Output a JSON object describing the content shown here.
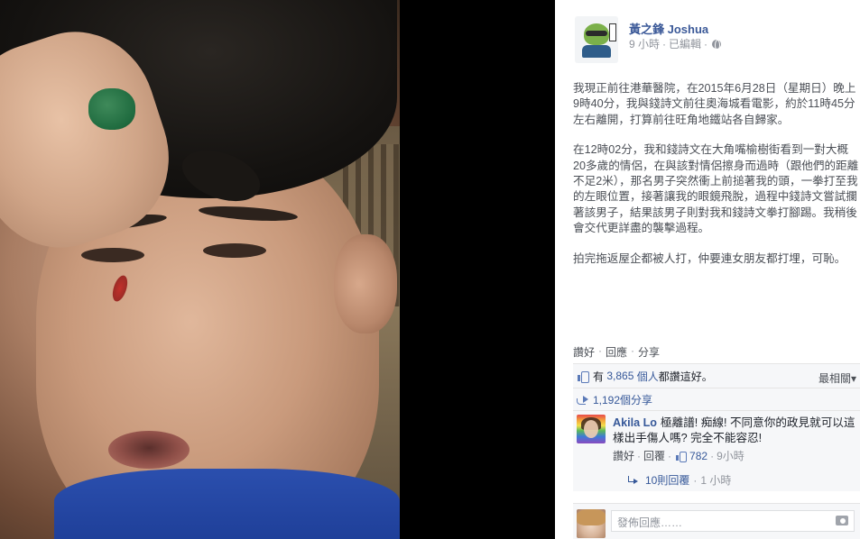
{
  "post": {
    "author": "黃之鋒 Joshua",
    "time": "9 小時",
    "edited": "已編輯",
    "dot": "·",
    "paragraphs": [
      "我現正前往港華醫院，在2015年6月28日（星期日）晚上9時40分，我與錢詩文前往奧海城看電影，約於11時45分左右離開，打算前往旺角地鐵站各自歸家。",
      "在12時02分，我和錢詩文在大角嘴榆樹街看到一對大概20多歲的情侶，在與該對情侶擦身而過時（跟他們的距離不足2米），那名男子突然衝上前搥著我的頭，一拳打至我的左眼位置，接著讓我的眼鏡飛脫，過程中錢詩文嘗試攔著該男子，結果該男子則對我和錢詩文拳打腳踢。我稍後會交代更詳盡的襲擊過程。",
      "拍完拖返屋企都被人打，仲要連女朋友都打埋，可恥。"
    ],
    "actions": {
      "like": "讚好",
      "comment": "回應",
      "share": "分享",
      "sep": "·"
    },
    "likes": {
      "prefix": "有",
      "count": "3,865",
      "suffix_people": "個人",
      "suffix_text": "都讚這好。",
      "sort_label": "最相關▾"
    },
    "shares": {
      "label": "1,192個分享"
    }
  },
  "comment": {
    "name": "Akila Lo",
    "text": "極離譜! 痴線! 不同意你的政見就可以這樣出手傷人嗎? 完全不能容忍!",
    "like_label": "讚好",
    "reply_label": "回覆",
    "like_count": "782",
    "time": "9小時",
    "sep": "·",
    "replies_label": "10則回覆",
    "replies_time": "1 小時"
  },
  "compose": {
    "placeholder": "發佈回應……"
  },
  "colors": {
    "link_blue": "#365899",
    "author_blue": "#3b5998",
    "meta_grey": "#90949c",
    "panel_bg": "#f6f7f9"
  }
}
